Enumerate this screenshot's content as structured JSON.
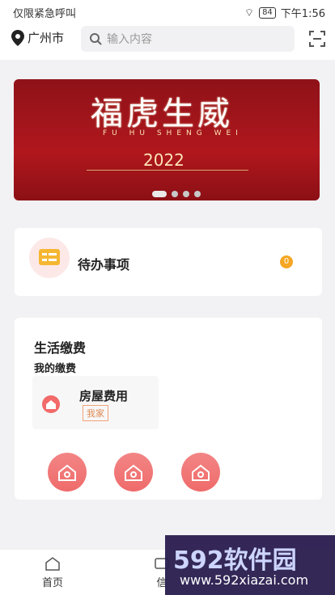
{
  "status_bar": {
    "left_text": "仅限紧急呼叫",
    "battery": "84",
    "time": "下午1:56"
  },
  "header": {
    "city": "广州市",
    "search_placeholder": "输入内容"
  },
  "banner": {
    "title": "福虎生威",
    "subtitle": "FU HU SHENG WEI",
    "year": "2022"
  },
  "todo": {
    "label": "待办事项",
    "count": "0"
  },
  "payments": {
    "section_title": "生活缴费",
    "sub_title": "我的缴费",
    "fee_name": "房屋费用",
    "fee_tag": "我家"
  },
  "tabbar": {
    "home": "首页",
    "second": "信"
  },
  "watermark": {
    "brand": "592软件园",
    "url": "www.592xiazai.com"
  },
  "colors": {
    "accent": "#f26a6a",
    "badge": "#f5a623",
    "banner_red": "#b0171d"
  }
}
